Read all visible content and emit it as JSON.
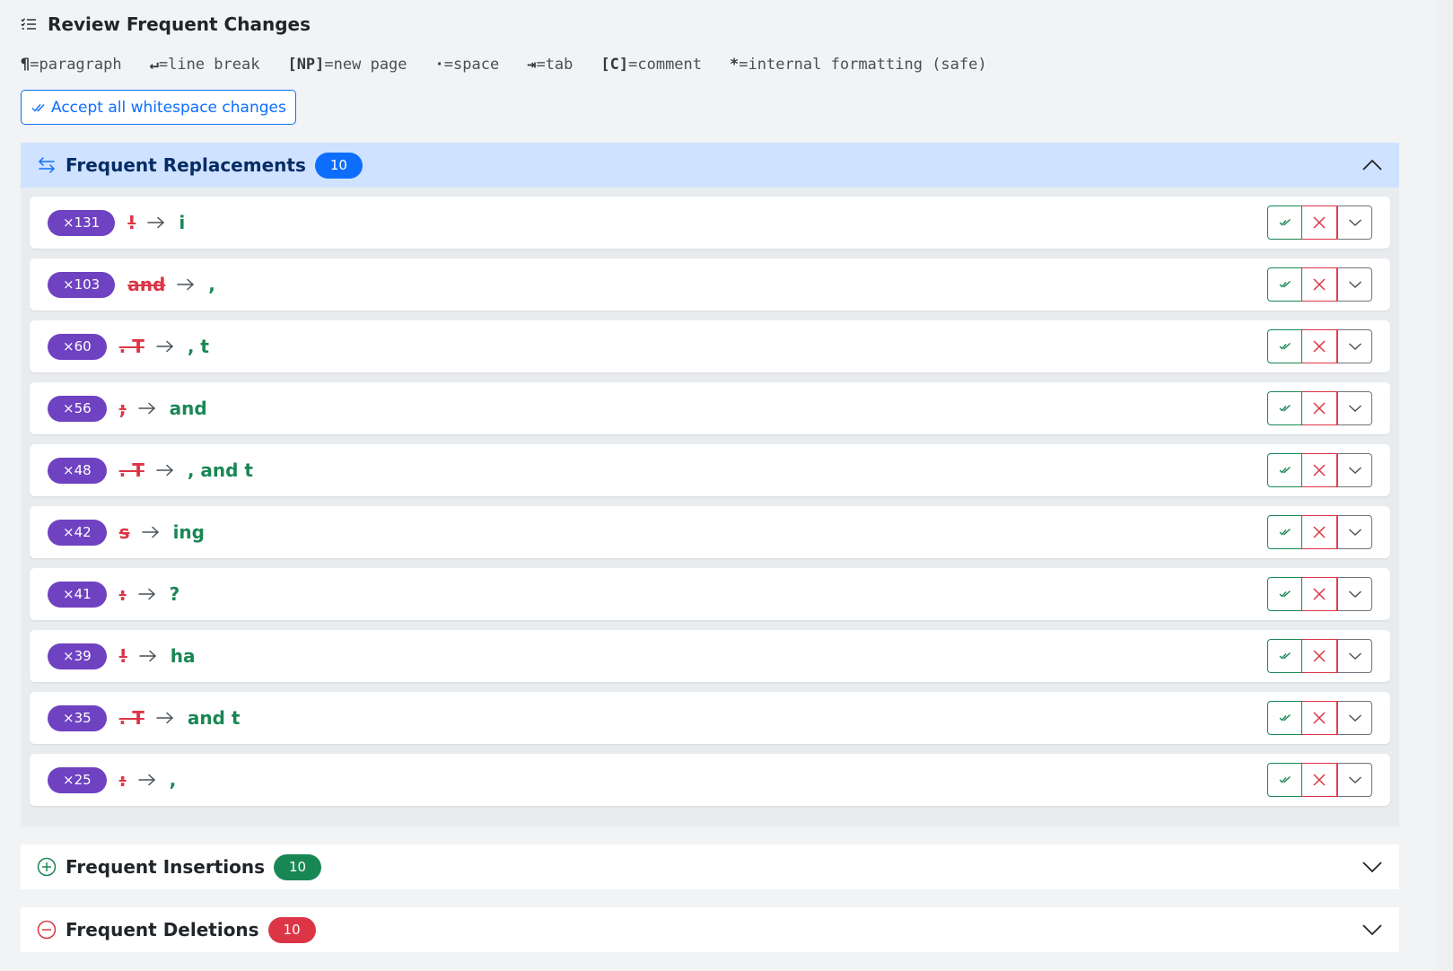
{
  "header": {
    "title": "Review Frequent Changes"
  },
  "legend": [
    {
      "sym": "¶",
      "desc": "=paragraph"
    },
    {
      "sym": "↵",
      "desc": "=line break"
    },
    {
      "sym": "[NP]",
      "desc": "=new page"
    },
    {
      "sym": "·",
      "desc": "=space"
    },
    {
      "sym": "⇥",
      "desc": "=tab"
    },
    {
      "sym": "[C]",
      "desc": "=comment"
    },
    {
      "sym": "*",
      "desc": "=internal formatting (safe)"
    }
  ],
  "accept_all_label": "Accept all whitespace changes",
  "colors": {
    "primary": "#0d6efd",
    "purple": "#6f42c1",
    "success": "#198754",
    "danger": "#dc3545"
  },
  "sections": {
    "replacements": {
      "title": "Frequent Replacements",
      "count": "10",
      "expanded": true,
      "rows": [
        {
          "freq": "×131",
          "from": "!",
          "to": "i"
        },
        {
          "freq": "×103",
          "from": "and",
          "to": ","
        },
        {
          "freq": "×60",
          "from": ". T",
          "to": ", t"
        },
        {
          "freq": "×56",
          "from": ";",
          "to": "and"
        },
        {
          "freq": "×48",
          "from": ". T",
          "to": ", and t"
        },
        {
          "freq": "×42",
          "from": "s",
          "to": "ing"
        },
        {
          "freq": "×41",
          "from": ":",
          "to": "?"
        },
        {
          "freq": "×39",
          "from": "!",
          "to": "ha"
        },
        {
          "freq": "×35",
          "from": ". T",
          "to": "and t"
        },
        {
          "freq": "×25",
          "from": ":",
          "to": ","
        }
      ]
    },
    "insertions": {
      "title": "Frequent Insertions",
      "count": "10",
      "expanded": false
    },
    "deletions": {
      "title": "Frequent Deletions",
      "count": "10",
      "expanded": false
    }
  }
}
